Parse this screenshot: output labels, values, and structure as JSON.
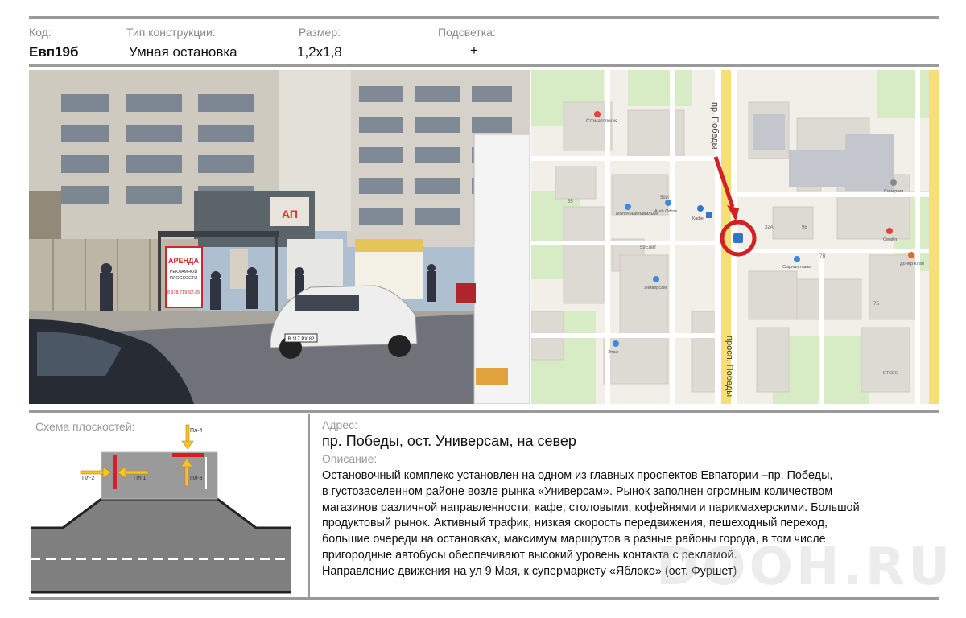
{
  "header": {
    "code_label": "Код:",
    "code_value": "Евп19б",
    "type_label": "Тип конструкции:",
    "type_value": "Умная остановка",
    "size_label": "Размер:",
    "size_value": "1,2х1,8",
    "light_label": "Подсветка:",
    "light_value": "+"
  },
  "photo": {
    "billboard_line1": "АРЕНДА",
    "billboard_line2": "РЕКЛАМНОЙ",
    "billboard_line3": "ПЛОСКОСТИ",
    "billboard_phone": "8 978 719-52-35",
    "store_sign": "АП",
    "plate": "В 117 РХ 82"
  },
  "map": {
    "street_top": "пр. Победы",
    "street_bottom": "просп. Победы",
    "poi": {
      "dentist": "Стоматология",
      "milk": "Молочный павильон",
      "arab": "Arab Odors",
      "kafe": "Кафе",
      "house59": "59И",
      "house59e": "59Елит",
      "house55": "55",
      "univ": "Универсам",
      "etazh": "Этаж",
      "synergy": "Синергия",
      "smile": "Смайл",
      "doner": "Донер Клаб",
      "cheese": "Сырная лавка",
      "h32a": "32А",
      "h9b": "9В",
      "h7b": "7В",
      "h7b2": "7Б",
      "etsco": "ЕТСЕО"
    }
  },
  "scheme": {
    "title": "Схема плоскостей:",
    "p1": "Пл-1",
    "p2": "Пл-2",
    "p3": "Пл-3",
    "p4": "Пл-4"
  },
  "address": {
    "label": "Адрес:",
    "value": "пр. Победы, ост. Универсам, на север"
  },
  "description": {
    "label": "Описание:",
    "lines": [
      "Остановочный комплекс установлен на одном из главных проспектов Евпатории –пр. Победы,",
      "в густозаселенном районе возле рынка «Универсам». Рынок заполнен огромным количеством",
      "магазинов различной направленности, кафе, столовыми, кофейнями и парикмахерскими. Большой",
      "продуктовый рынок. Активный трафик, низкая скорость передвижения, пешеходный переход,",
      "большие очереди на остановках, максимум маршрутов в разные районы города, в том числе",
      "пригородные автобусы обеспечивают высокий уровень контакта с рекламой.",
      "Направление движения на ул 9 Мая, к супермаркету «Яблоко» (ост. Фуршет)"
    ]
  },
  "watermark": "DOOH.RU",
  "colors": {
    "rule": "#9a9a9a",
    "accent_red": "#d31f26",
    "arrow_yellow": "#f5c32c"
  }
}
